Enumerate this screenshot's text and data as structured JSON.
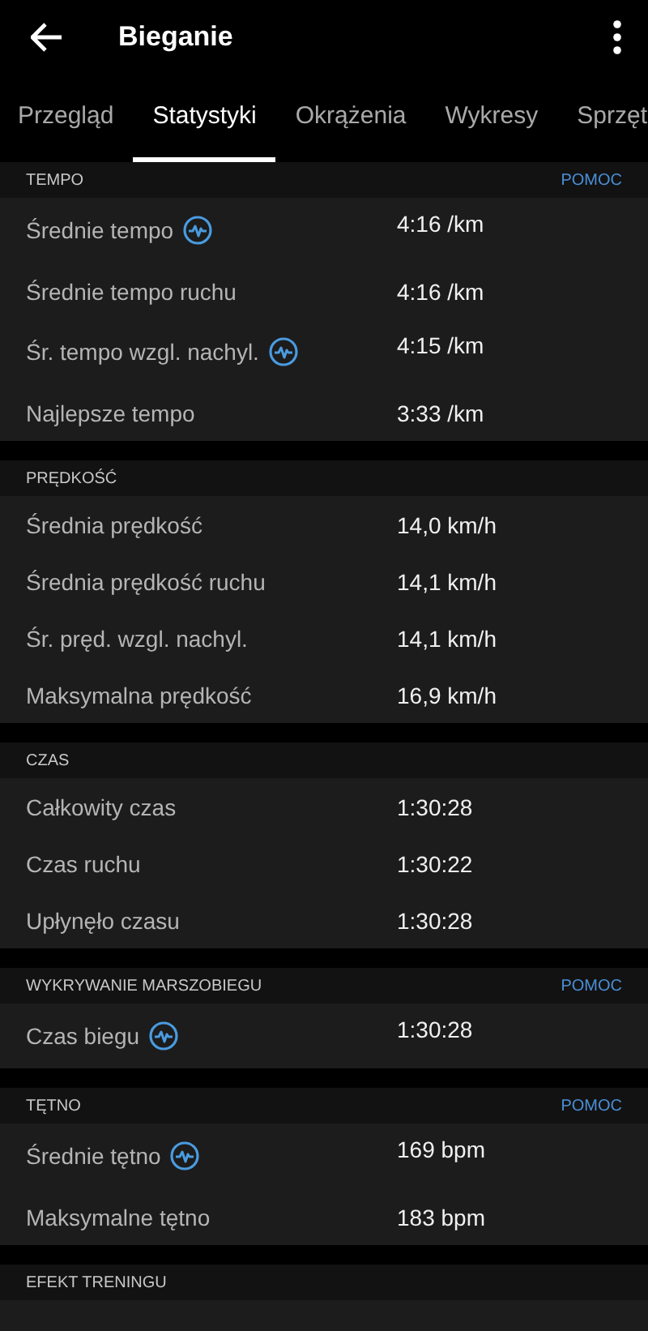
{
  "header": {
    "title": "Bieganie"
  },
  "tabs": [
    {
      "label": "Przegląd",
      "selected": false
    },
    {
      "label": "Statystyki",
      "selected": true
    },
    {
      "label": "Okrążenia",
      "selected": false
    },
    {
      "label": "Wykresy",
      "selected": false
    },
    {
      "label": "Sprzęt",
      "selected": false
    }
  ],
  "sections": [
    {
      "title": "TEMPO",
      "help": "POMOC",
      "rows": [
        {
          "label": "Średnie tempo",
          "value": "4:16 /km",
          "icon": true
        },
        {
          "label": "Średnie tempo ruchu",
          "value": "4:16 /km",
          "icon": false
        },
        {
          "label": "Śr. tempo wzgl. nachyl.",
          "value": "4:15 /km",
          "icon": true
        },
        {
          "label": "Najlepsze tempo",
          "value": "3:33 /km",
          "icon": false
        }
      ]
    },
    {
      "title": "PRĘDKOŚĆ",
      "rows": [
        {
          "label": "Średnia prędkość",
          "value": "14,0 km/h",
          "icon": false
        },
        {
          "label": "Średnia prędkość ruchu",
          "value": "14,1 km/h",
          "icon": false
        },
        {
          "label": "Śr. pręd. wzgl. nachyl.",
          "value": "14,1 km/h",
          "icon": false
        },
        {
          "label": "Maksymalna prędkość",
          "value": "16,9 km/h",
          "icon": false
        }
      ]
    },
    {
      "title": "CZAS",
      "rows": [
        {
          "label": "Całkowity czas",
          "value": "1:30:28",
          "icon": false
        },
        {
          "label": "Czas ruchu",
          "value": "1:30:22",
          "icon": false
        },
        {
          "label": "Upłynęło czasu",
          "value": "1:30:28",
          "icon": false
        }
      ]
    },
    {
      "title": "WYKRYWANIE MARSZOBIEGU",
      "help": "POMOC",
      "rows": [
        {
          "label": "Czas biegu",
          "value": "1:30:28",
          "icon": true
        }
      ]
    },
    {
      "title": "TĘTNO",
      "help": "POMOC",
      "rows": [
        {
          "label": "Średnie tętno",
          "value": "169 bpm",
          "icon": true
        },
        {
          "label": "Maksymalne tętno",
          "value": "183 bpm",
          "icon": false
        }
      ]
    },
    {
      "title": "EFEKT TRENINGU"
    }
  ]
}
